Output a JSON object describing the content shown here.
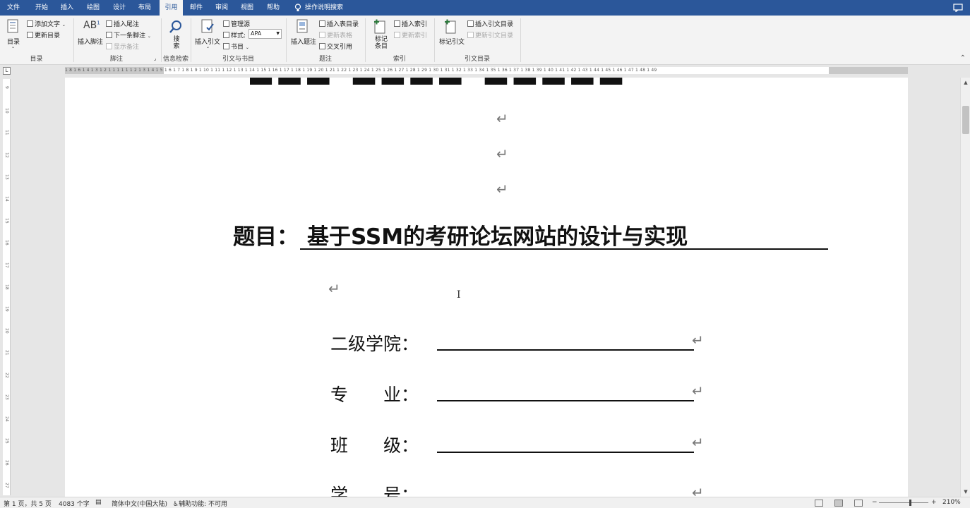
{
  "tabs": [
    {
      "label": "文件",
      "active": false
    },
    {
      "label": "开始",
      "active": false
    },
    {
      "label": "插入",
      "active": false
    },
    {
      "label": "绘图",
      "active": false
    },
    {
      "label": "设计",
      "active": false
    },
    {
      "label": "布局",
      "active": false
    },
    {
      "label": "引用",
      "active": true
    },
    {
      "label": "邮件",
      "active": false
    },
    {
      "label": "审阅",
      "active": false
    },
    {
      "label": "视图",
      "active": false
    },
    {
      "label": "帮助",
      "active": false
    }
  ],
  "tell_me": "操作说明搜索",
  "ribbon": {
    "toc": {
      "big": "目录",
      "add_text": "添加文字",
      "update_toc": "更新目录",
      "group": "目录"
    },
    "footnotes": {
      "insert_footnote": "插入脚注",
      "insert_endnote": "插入尾注",
      "next_footnote": "下一条脚注",
      "show_notes": "显示备注",
      "group": "脚注"
    },
    "research": {
      "search": "搜索",
      "group": "信息检索"
    },
    "citations": {
      "insert_citation": "插入引文",
      "manage_sources": "管理源",
      "style_label": "样式:",
      "style_value": "APA",
      "bibliography": "书目",
      "group": "引文与书目"
    },
    "captions": {
      "insert_caption": "插入题注",
      "insert_table_of_figures": "插入表目录",
      "update_table": "更新表格",
      "cross_reference": "交叉引用",
      "group": "题注"
    },
    "index": {
      "mark_entry": "标记条目",
      "insert_index": "插入索引",
      "update_index": "更新索引",
      "group": "索引"
    },
    "toa": {
      "mark_citation": "标记引文",
      "insert_toa": "插入引文目录",
      "update_toa": "更新引文目录",
      "group": "引文目录"
    }
  },
  "ruler_numbers": "1  8  1  6  1  4  1  3  1  2  1  1  1      1  1  1  2  1  3  1  4  1  5  1  6  1  7  1  8  1  9  1  10  1  11  1  12  1  13  1  14  1  15  1  16  1  17  1  18  1  19  1  20  1  21  1  22  1  23  1  24  1  25  1  26  1  27  1  28  1  29  1  30  1  31  1  32  1  33  1  34  1  35  1  36  1  37  1  38  1  39  1  40  1  41  1  42  1  43  1  44  1  45  1  46  1  47  1  48  1  49",
  "vruler_numbers": [
    "9",
    "10",
    "11",
    "12",
    "13",
    "14",
    "15",
    "16",
    "17",
    "18",
    "19",
    "20",
    "21",
    "22",
    "23",
    "24",
    "25",
    "26",
    "27"
  ],
  "document": {
    "return_mark": "↵",
    "title_prefix": "题目：",
    "title_text": "基于SSM的考研论坛网站的设计与实现",
    "fields": [
      {
        "label": "二级学院："
      },
      {
        "label": "专　　业："
      },
      {
        "label": "班　　级："
      },
      {
        "label": "学　　号："
      }
    ],
    "cursor": "I"
  },
  "status_bar": {
    "page": "第 1 页，共 5 页",
    "words": "4083 个字",
    "language": "简体中文(中国大陆)",
    "accessibility": "辅助功能: 不可用",
    "zoom": "210%",
    "zoom_minus": "−",
    "zoom_plus": "+"
  }
}
